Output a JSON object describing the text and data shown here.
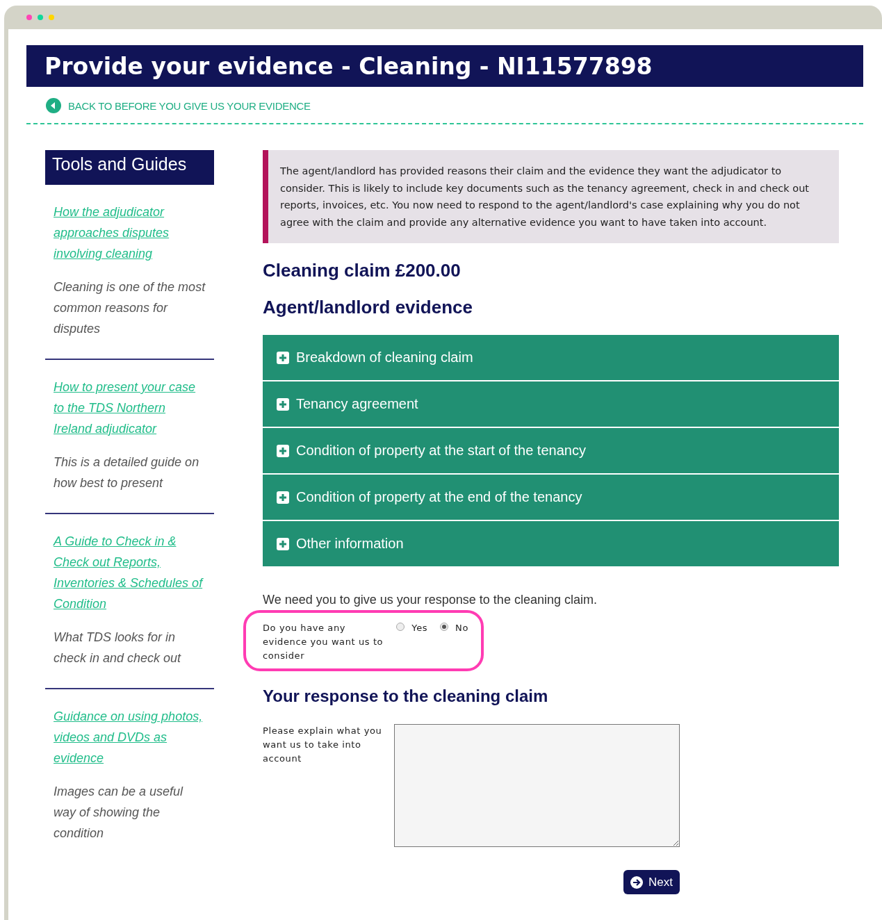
{
  "window": {
    "dots": [
      {
        "color": "#ff45b5"
      },
      {
        "color": "#10d89a"
      },
      {
        "color": "#ffd600"
      }
    ]
  },
  "page_title": "Provide your evidence - Cleaning - NI11577898",
  "back_link": "BACK TO BEFORE YOU GIVE US YOUR EVIDENCE",
  "sidebar": {
    "title": "Tools and Guides",
    "items": [
      {
        "link": "How the adjudicator approaches disputes involving cleaning",
        "description": "Cleaning is one of the most common reasons for disputes"
      },
      {
        "link": "How to present your case to the TDS Northern Ireland adjudicator",
        "description": "This is a detailed guide on how best to present"
      },
      {
        "link": "A Guide to Check in & Check out Reports, Inventories & Schedules of Condition",
        "description": "What TDS looks for in check in and check out"
      },
      {
        "link": "Guidance on using photos, videos and DVDs as evidence",
        "description": "Images can be a useful way of showing the condition"
      }
    ]
  },
  "notice": "The agent/landlord has provided reasons their claim and the evidence they want the adjudicator to consider. This is likely to include key documents such as the tenancy agreement, check in and check out reports, invoices, etc. You now need to respond to the agent/landlord's case explaining why you do not agree with the claim and provide any alternative evidence you want to have taken into account.",
  "claim_heading": "Cleaning claim £200.00",
  "evidence_heading": "Agent/landlord evidence",
  "accordion": [
    {
      "label": "Breakdown of cleaning claim",
      "expanded": false
    },
    {
      "label": "Tenancy agreement",
      "expanded": false
    },
    {
      "label": "Condition of property at the start of the tenancy",
      "expanded": false
    },
    {
      "label": "Condition of property at the end of the tenancy",
      "expanded": false
    },
    {
      "label": "Other information",
      "expanded": false
    }
  ],
  "intro": "We need you to give us your response to the cleaning claim.",
  "question": {
    "label": "Do you have any evidence you want us to consider",
    "highlighted": true,
    "options": [
      {
        "label": "Yes",
        "selected": false
      },
      {
        "label": "No",
        "selected": true
      }
    ]
  },
  "response_heading": "Your response to the cleaning claim",
  "response_field": {
    "label": "Please explain what you want us to take into account"
  },
  "next_button": "Next"
}
